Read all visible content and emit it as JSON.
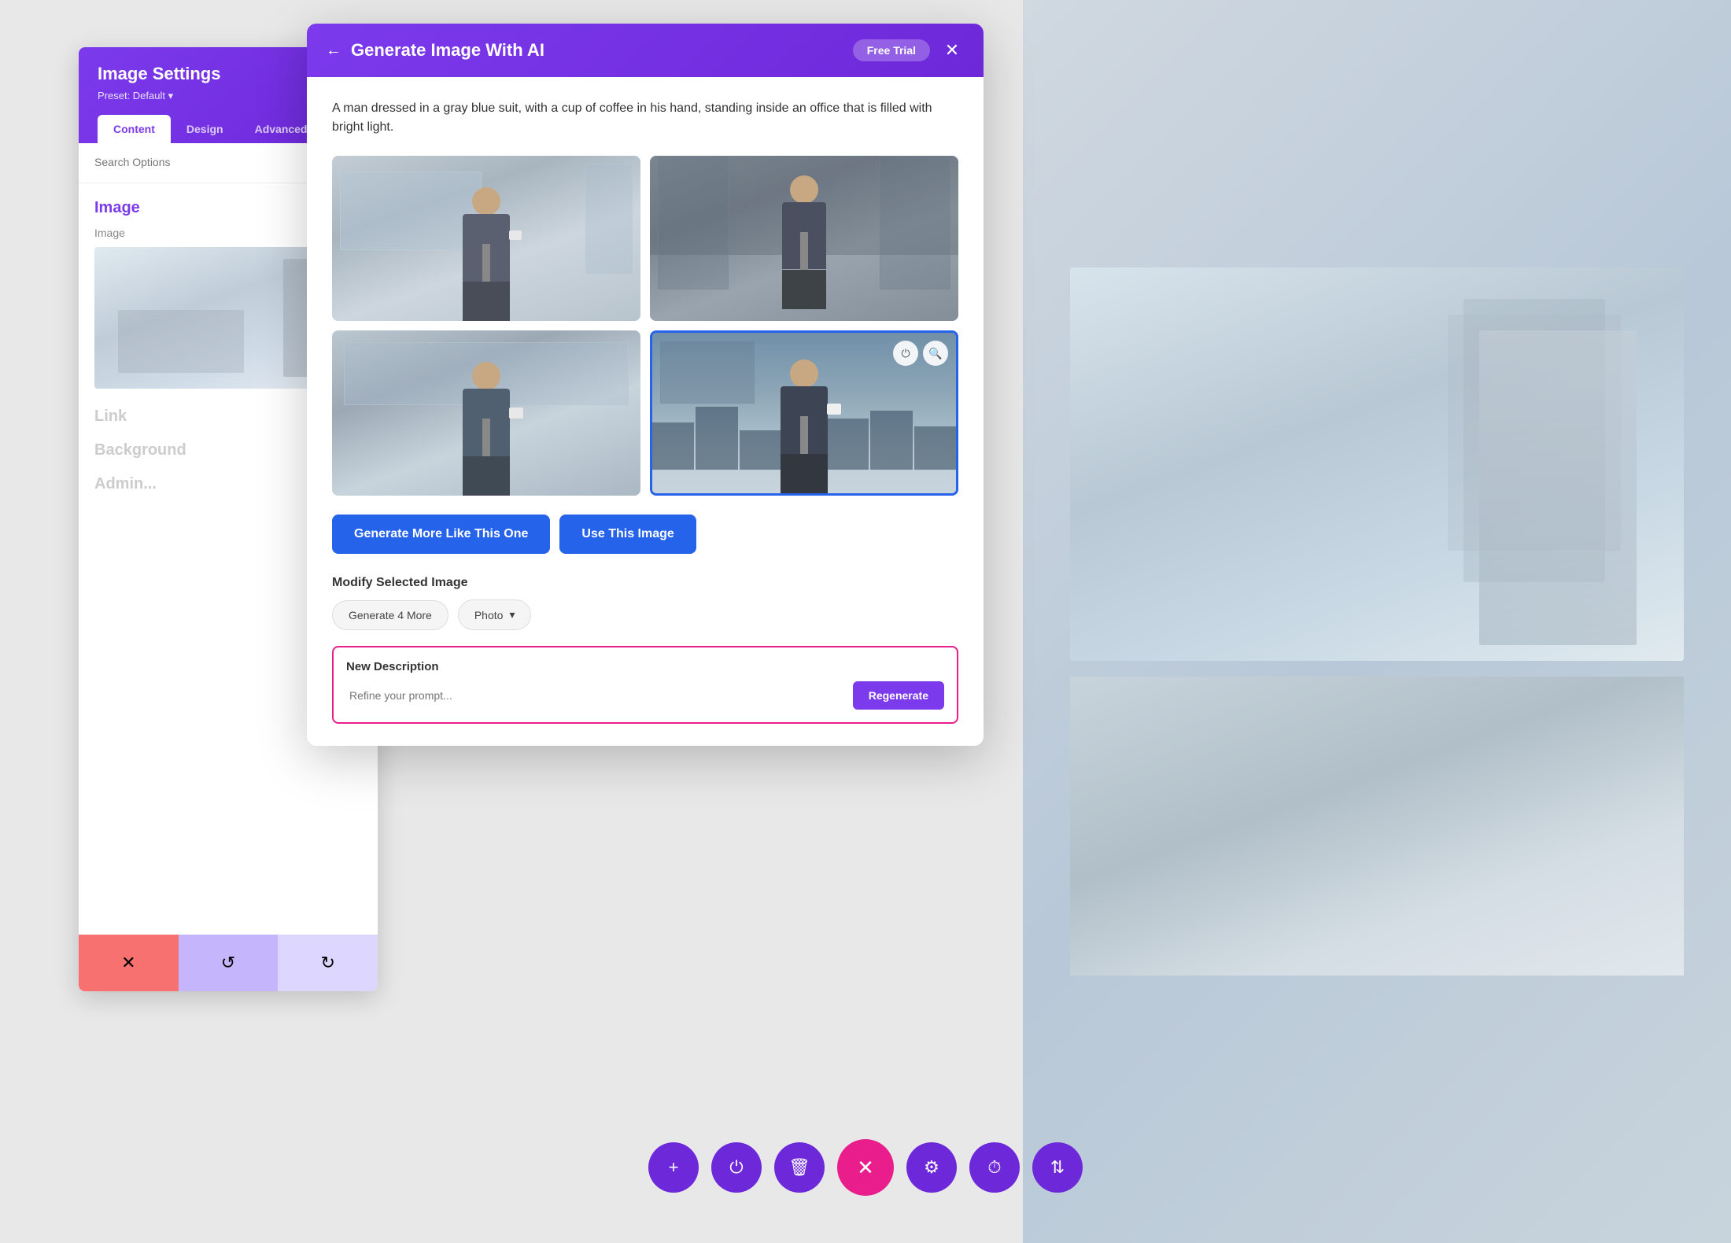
{
  "background": {
    "color": "#e0e4e8"
  },
  "image_settings": {
    "title": "Image Settings",
    "preset": "Preset: Default ▾",
    "settings_icon": "⚙",
    "tabs": [
      "Content",
      "Design",
      "Advanced"
    ],
    "active_tab": "Content",
    "search_placeholder": "Search Options",
    "sections": {
      "image": {
        "label": "Image",
        "sub_label": "Image"
      },
      "link": {
        "label": "Link"
      },
      "background": {
        "label": "Background"
      },
      "admin": {
        "label": "Admin..."
      }
    },
    "actions": {
      "cancel": "✕",
      "undo": "↺",
      "redo": "↻"
    }
  },
  "modal": {
    "title": "Generate Image With AI",
    "back_icon": "←",
    "free_trial": "Free Trial",
    "close_icon": "✕",
    "prompt_text": "A man dressed in a gray blue suit, with a cup of coffee in his hand, standing inside an office that is filled with bright light.",
    "images": [
      {
        "id": 1,
        "selected": false
      },
      {
        "id": 2,
        "selected": false
      },
      {
        "id": 3,
        "selected": false
      },
      {
        "id": 4,
        "selected": true
      }
    ],
    "buttons": {
      "generate_more": "Generate More Like This One",
      "use_image": "Use This Image"
    },
    "modify": {
      "title": "Modify Selected Image",
      "generate_more_btn": "Generate 4 More",
      "photo_option": "Photo",
      "chevron": "▾"
    },
    "new_description": {
      "title": "New Description",
      "placeholder": "Refine your prompt...",
      "regenerate_btn": "Regenerate"
    }
  },
  "toolbar": {
    "buttons": [
      {
        "icon": "+",
        "label": "add"
      },
      {
        "icon": "⏻",
        "label": "power"
      },
      {
        "icon": "🗑",
        "label": "delete"
      },
      {
        "icon": "✕",
        "label": "close",
        "active": true
      },
      {
        "icon": "⚙",
        "label": "settings"
      },
      {
        "icon": "⏱",
        "label": "history"
      },
      {
        "icon": "⇅",
        "label": "sort"
      }
    ]
  }
}
